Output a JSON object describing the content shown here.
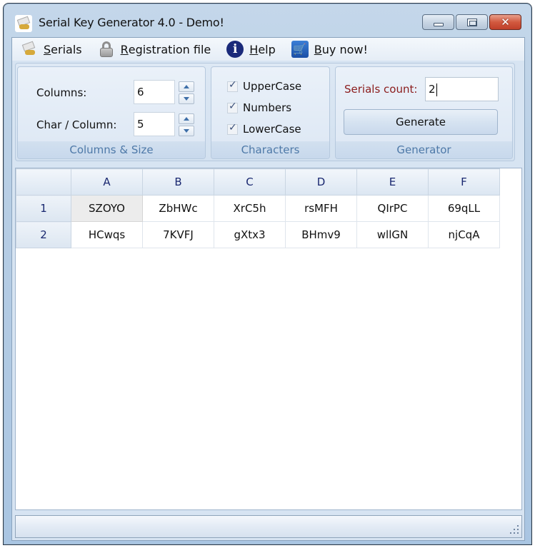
{
  "window": {
    "title": "Serial Key Generator 4.0 - Demo!",
    "controls": {
      "minimize": "minimize",
      "maximize": "maximize",
      "close": "✕"
    }
  },
  "menu": {
    "items": [
      {
        "icon": "serials-keys-icon",
        "accel": "S",
        "rest": "erials"
      },
      {
        "icon": "lock-icon",
        "accel": "R",
        "rest": "egistration file"
      },
      {
        "icon": "info-icon",
        "glyph": "i",
        "accel": "H",
        "rest": "elp"
      },
      {
        "icon": "cart-icon",
        "glyph": "🛒",
        "accel": "B",
        "rest": "uy now!"
      }
    ]
  },
  "ribbon": {
    "columns_size": {
      "label": "Columns & Size",
      "columns_label": "Columns:",
      "columns_value": "6",
      "chars_label": "Char / Column:",
      "chars_value": "5"
    },
    "characters": {
      "label": "Characters",
      "options": [
        {
          "label": "UpperCase",
          "checked": true
        },
        {
          "label": "Numbers",
          "checked": true
        },
        {
          "label": "LowerCase",
          "checked": true
        }
      ]
    },
    "generator": {
      "label": "Generator",
      "serials_count_label": "Serials count:",
      "serials_count_value": "2",
      "generate_label": "Generate"
    }
  },
  "grid": {
    "columns": [
      "A",
      "B",
      "C",
      "D",
      "E",
      "F"
    ],
    "rows": [
      {
        "index": "1",
        "cells": [
          "SZOYO",
          "ZbHWc",
          "XrC5h",
          "rsMFH",
          "QIrPC",
          "69qLL"
        ]
      },
      {
        "index": "2",
        "cells": [
          "HCwqs",
          "7KVFJ",
          "gXtx3",
          "BHmv9",
          "wllGN",
          "njCqA"
        ]
      }
    ],
    "selected": {
      "row": 0,
      "col": 0
    }
  },
  "colors": {
    "group_label": "#4e79a8",
    "serials_label": "#8b1c1c",
    "grid_header_text": "#1a2870"
  }
}
